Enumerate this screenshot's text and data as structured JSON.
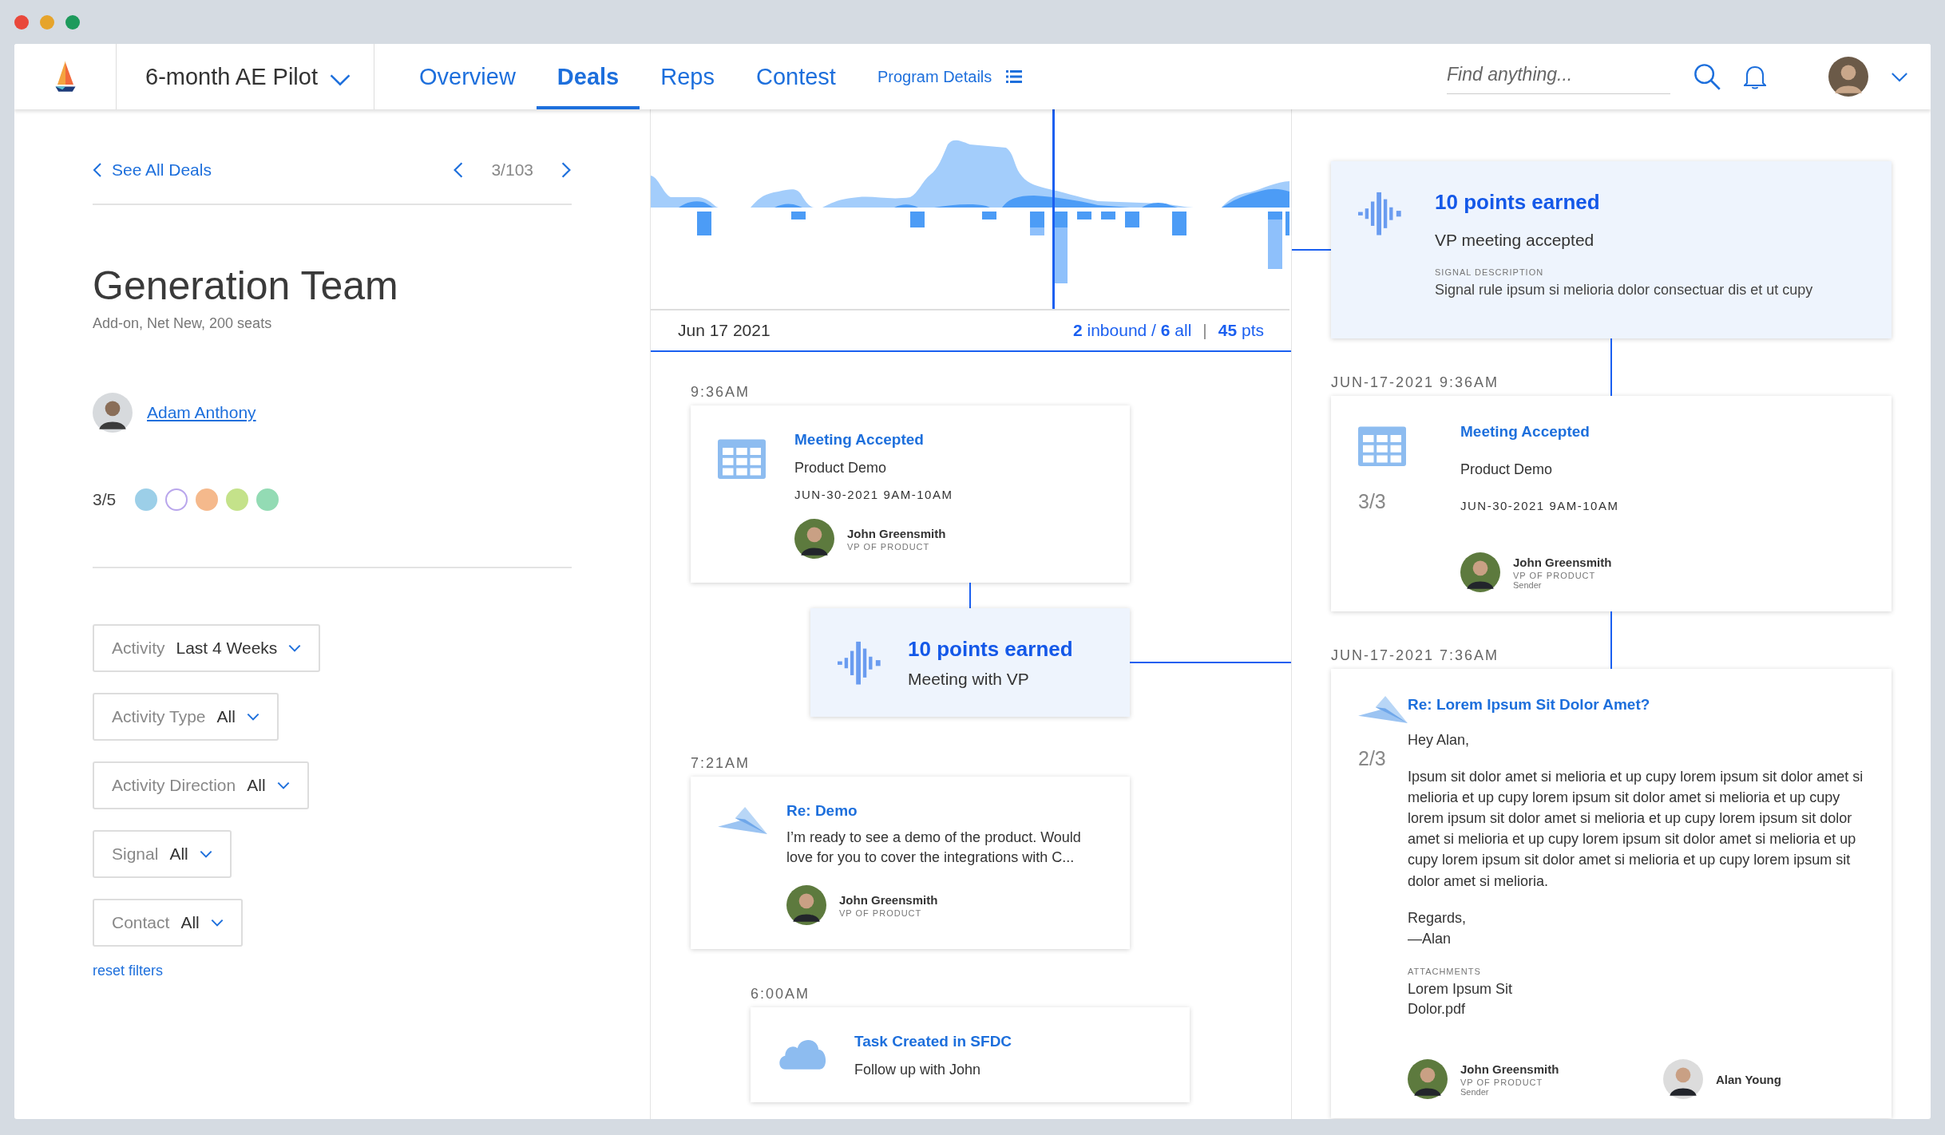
{
  "header": {
    "program": "6-month AE Pilot",
    "tabs": [
      {
        "label": "Overview",
        "selected": false
      },
      {
        "label": "Deals",
        "selected": true
      },
      {
        "label": "Reps",
        "selected": false
      },
      {
        "label": "Contest",
        "selected": false
      }
    ],
    "program_details": "Program Details",
    "search": {
      "placeholder": "Find anything..."
    }
  },
  "deal": {
    "back": "See All Deals",
    "position": "3/103",
    "title": "Generation Team",
    "subtitle": "Add-on, Net New, 200 seats",
    "owner": "Adam Anthony",
    "progress": "3/5",
    "dots": [
      {
        "color": "#9ccfe8",
        "filled": true
      },
      {
        "color": "#b9a6ec",
        "filled": false
      },
      {
        "color": "#f5b98c",
        "filled": true
      },
      {
        "color": "#c4e28a",
        "filled": true
      },
      {
        "color": "#93dbb4",
        "filled": true
      }
    ]
  },
  "filters": [
    {
      "label": "Activity",
      "value": "Last 4 Weeks"
    },
    {
      "label": "Activity Type",
      "value": "All"
    },
    {
      "label": "Activity Direction",
      "value": "All"
    },
    {
      "label": "Signal",
      "value": "All"
    },
    {
      "label": "Contact",
      "value": "All"
    }
  ],
  "reset_filters": "reset filters",
  "timeline": {
    "date": "Jun 17 2021",
    "summary": "**2** inbound / **6** all",
    "separator": "|",
    "points": "**45** pts",
    "events": [
      {
        "kind": "meeting",
        "time": "9:36AM",
        "title": "Meeting Accepted",
        "subtitle": "Product Demo",
        "date": "JUN-30-2021 9AM-10AM",
        "contact": {
          "name": "John Greensmith",
          "role": "VP OF PRODUCT"
        }
      },
      {
        "kind": "signal",
        "title": "10 points earned",
        "text": "Meeting with VP"
      },
      {
        "kind": "email",
        "time": "7:21AM",
        "title": "Re: Demo",
        "body": "I’m ready to see a demo of the product. Would love for you to cover the integrations with C...",
        "contact": {
          "name": "John Greensmith",
          "role": "VP OF PRODUCT"
        }
      },
      {
        "kind": "task",
        "time": "6:00AM",
        "title": "Task Created in SFDC",
        "subtitle": "Follow up with John"
      }
    ]
  },
  "detail": {
    "signal": {
      "title": "10 points earned",
      "text": "VP meeting accepted",
      "description_label": "SIGNAL DESCRIPTION",
      "description": "Signal rule ipsum si melioria dolor consectuar dis et ut cupy"
    },
    "entries": [
      {
        "kind": "meeting",
        "timestamp": "JUN-17-2021 9:36AM",
        "count": "3/3",
        "title": "Meeting Accepted",
        "subtitle": "Product Demo",
        "date": "JUN-30-2021 9AM-10AM",
        "contacts": [
          {
            "name": "John Greensmith",
            "role": "VP OF PRODUCT",
            "note": "Sender"
          }
        ]
      },
      {
        "kind": "email",
        "timestamp": "JUN-17-2021 7:36AM",
        "count": "2/3",
        "title": "Re: Lorem Ipsum Sit Dolor Amet?",
        "greeting": "Hey Alan,",
        "body": "Ipsum sit dolor amet si melioria et up cupy lorem ipsum sit dolor amet si melioria et up cupy lorem ipsum sit dolor amet si melioria et up cupy lorem ipsum sit dolor amet si melioria et up cupy lorem ipsum sit dolor amet si melioria et up cupy lorem ipsum sit dolor amet si melioria et up cupy lorem ipsum sit dolor amet si melioria et up cupy lorem ipsum sit dolor amet si melioria.",
        "closing": [
          "Regards,",
          "—Alan"
        ],
        "attachments_label": "ATTACHMENTS",
        "attachment": "Lorem Ipsum Sit Dolor.pdf",
        "contacts": [
          {
            "name": "John Greensmith",
            "role": "VP OF PRODUCT",
            "note": "Sender"
          },
          {
            "name": "Alan Young"
          }
        ]
      }
    ]
  }
}
